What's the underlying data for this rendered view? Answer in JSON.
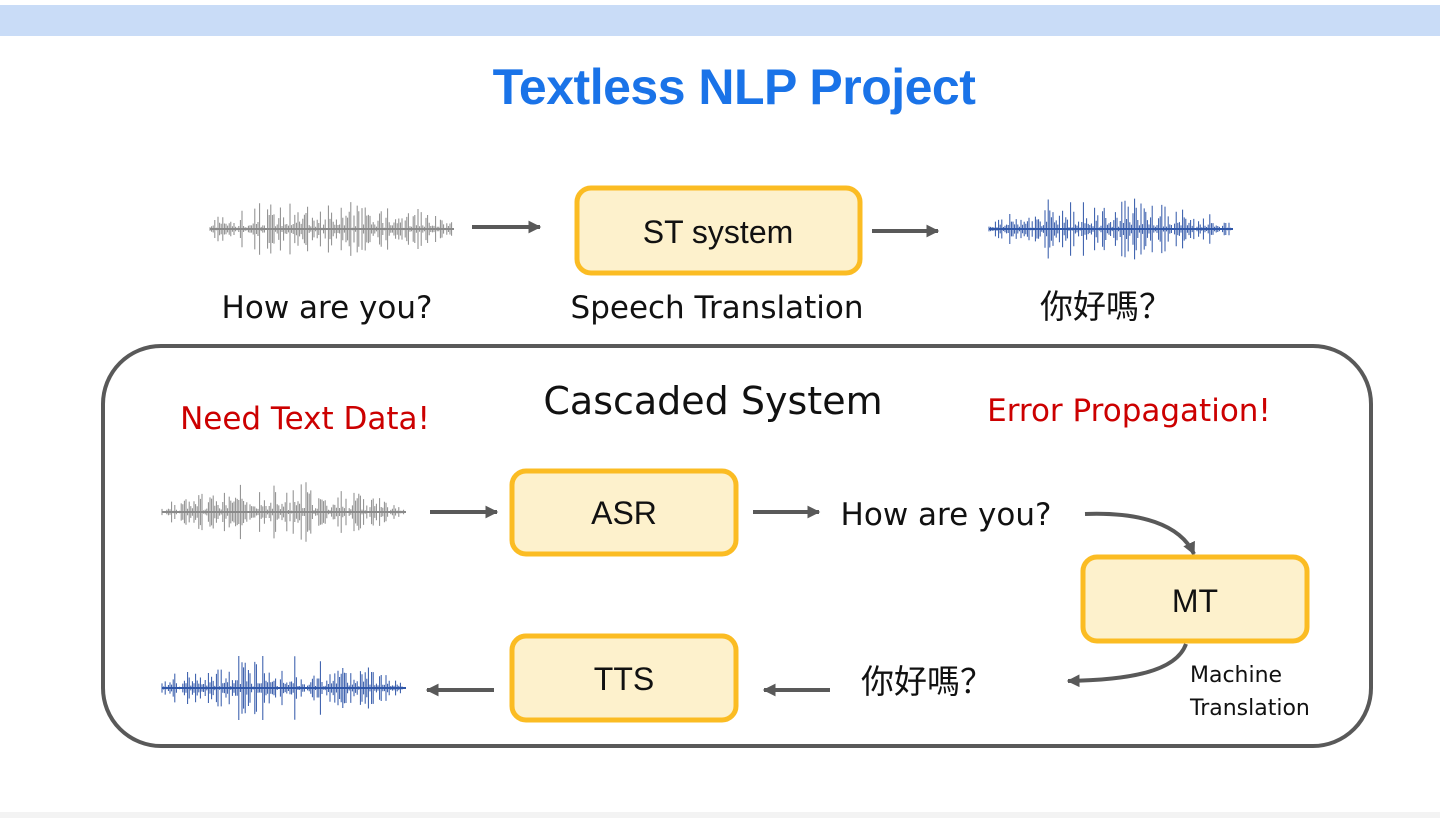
{
  "title": "Textless NLP Project",
  "colors": {
    "title": "#1a73e8",
    "band": "#c9dcf7",
    "box_fill": "#fdf1cc",
    "box_stroke": "#fbbc23",
    "arrow": "#595959",
    "warning": "#cc0000",
    "wave_source": "#8a8a8a",
    "wave_target": "#2f56a8",
    "frame": "#595959"
  },
  "top_row": {
    "source_caption": "How are you?",
    "system_box": "ST system",
    "system_caption": "Speech Translation",
    "target_caption": "你好嗎？"
  },
  "cascade": {
    "title": "Cascaded System",
    "warning_left": "Need Text Data!",
    "warning_right": "Error Propagation!",
    "asr_box": "ASR",
    "asr_output": "How are you?",
    "mt_box": "MT",
    "mt_caption_line1": "Machine",
    "mt_caption_line2": "Translation",
    "mt_output": "你好嗎？",
    "tts_box": "TTS"
  },
  "icons": {
    "source_wave": "speech-waveform-icon",
    "target_wave": "speech-waveform-icon"
  }
}
